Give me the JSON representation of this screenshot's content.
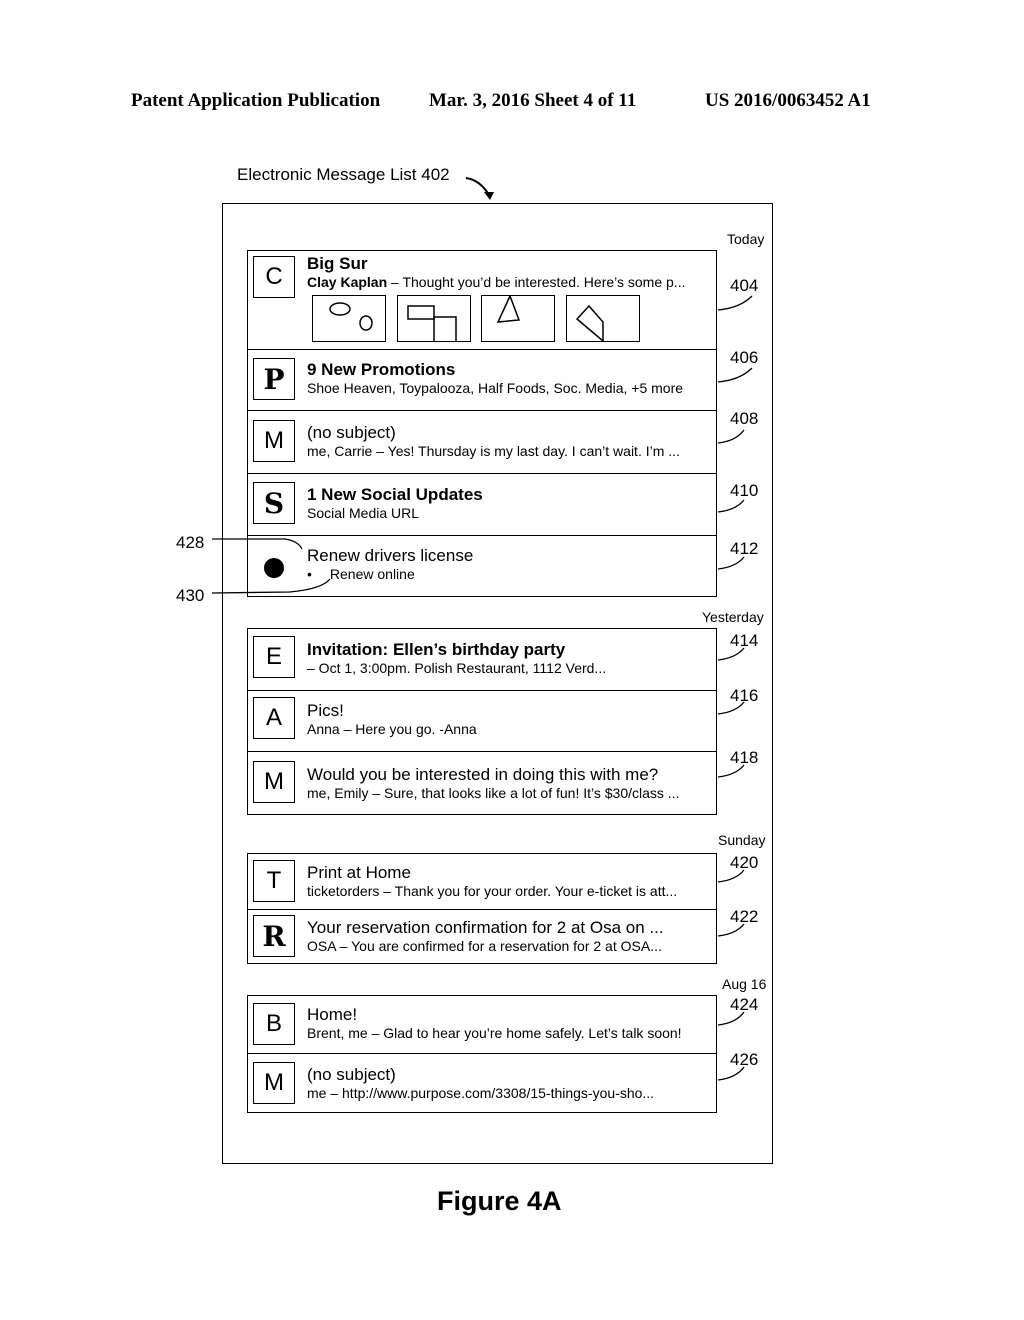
{
  "header": {
    "publication": "Patent Application Publication",
    "date_sheet": "Mar. 3, 2016   Sheet 4 of 11",
    "patent_number": "US 2016/0063452 A1"
  },
  "list_title": "Electronic Message List 402",
  "figure_caption": "Figure 4A",
  "groups": [
    {
      "date": "Today",
      "items": [
        {
          "ref": "404",
          "avatar": "C",
          "subject": "Big Sur",
          "sender": "Clay Kaplan",
          "preview": " – Thought you’d be interested. Here’s some p...",
          "thumbnails": [
            "ovals-image",
            "rectangles-image",
            "triangle-image",
            "polygon-image"
          ]
        },
        {
          "ref": "406",
          "avatar": "P",
          "subject": "9 New Promotions",
          "preview": "Shoe Heaven, Toypalooza, Half Foods, Soc. Media, +5 more"
        },
        {
          "ref": "408",
          "avatar": "M",
          "subject": "(no subject)",
          "preview": "me, Carrie – Yes! Thursday is my last day. I can’t wait. I’m ..."
        },
        {
          "ref": "410",
          "avatar": "S",
          "subject": "1 New Social Updates",
          "preview": "Social Media URL"
        },
        {
          "ref": "412",
          "avatar": "●",
          "subject": "Renew drivers license",
          "preview": "Renew online",
          "bullet": "•"
        }
      ]
    },
    {
      "date": "Yesterday",
      "items": [
        {
          "ref": "414",
          "avatar": "E",
          "subject": "Invitation: Ellen’s birthday party",
          "preview": "– Oct 1, 3:00pm. Polish  Restaurant, 1112 Verd..."
        },
        {
          "ref": "416",
          "avatar": "A",
          "subject": "Pics!",
          "preview": "Anna – Here you go. -Anna"
        },
        {
          "ref": "418",
          "avatar": "M",
          "subject": "Would you be interested in doing this with me?",
          "preview": "me, Emily – Sure, that looks like a lot of fun! It’s $30/class ..."
        }
      ]
    },
    {
      "date": "Sunday",
      "items": [
        {
          "ref": "420",
          "avatar": "T",
          "subject": "Print at Home",
          "preview": "ticketorders – Thank you for your order. Your e-ticket is att..."
        },
        {
          "ref": "422",
          "avatar": "R",
          "subject": "Your reservation confirmation for 2 at Osa on ...",
          "preview": "OSA – You are confirmed for a reservation for 2 at OSA..."
        }
      ]
    },
    {
      "date": "Aug 16",
      "items": [
        {
          "ref": "424",
          "avatar": "B",
          "subject": "Home!",
          "preview": "Brent, me – Glad to hear you’re home safely. Let’s talk soon!"
        },
        {
          "ref": "426",
          "avatar": "M",
          "subject": "(no subject)",
          "preview": "me – http://www.purpose.com/3308/15-things-you-sho..."
        }
      ]
    }
  ],
  "callouts": {
    "task_title_ref": "428",
    "subtask_ref": "430"
  }
}
